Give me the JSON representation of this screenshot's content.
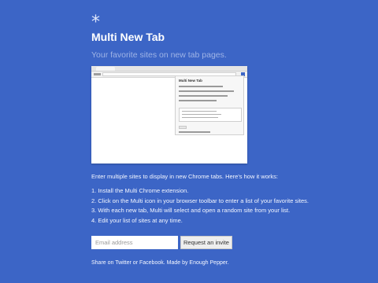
{
  "brand": {
    "logo_glyph": "*",
    "title": "Multi New Tab",
    "tagline": "Your favorite sites on new tab pages."
  },
  "screenshot": {
    "popup_title": "Multi New Tab",
    "icon": "multi-extension-icon"
  },
  "intro": "Enter multiple sites to display in new Chrome tabs. Here's how it works:",
  "steps": [
    "1. Install the Multi Chrome extension.",
    "2. Click on the Multi icon in your browser toolbar to enter a list of your favorite sites.",
    "3. With each new tab, Multi will select and open a random site from your list.",
    "4. Edit your list of sites at any time."
  ],
  "signup": {
    "email_placeholder": "Email address",
    "button_label": "Request an invite"
  },
  "footer": {
    "prefix": "Share on ",
    "twitter": "Twitter",
    "or": " or ",
    "facebook": "Facebook",
    "made_by": ". Made by ",
    "author": "Enough Pepper",
    "suffix": "."
  },
  "colors": {
    "background": "#3c65c6",
    "muted_text": "#9fb4e6"
  }
}
